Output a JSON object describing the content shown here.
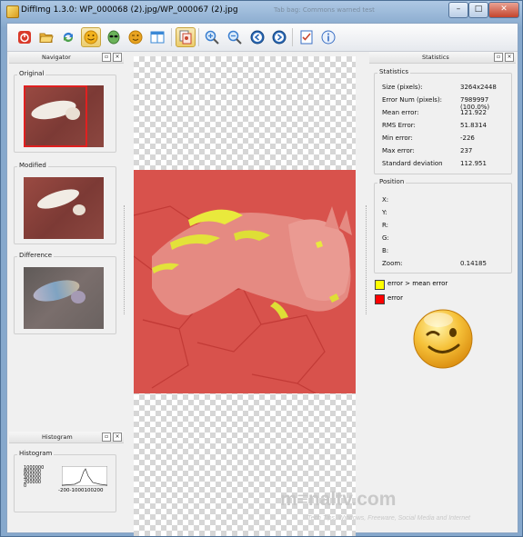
{
  "window": {
    "title": "DiffImg 1.3.0: WP_000068 (2).jpg/WP_000067 (2).jpg",
    "ghost_title": "Tab bag: Commons warned test",
    "buttons": {
      "minimize": "–",
      "maximize": "□",
      "close": "✕"
    }
  },
  "toolbar": {
    "items": [
      {
        "name": "quit-icon",
        "color": "#d93a2a"
      },
      {
        "name": "folder-open-icon",
        "color": "#f0b940"
      },
      {
        "name": "refresh-icon",
        "color": "#2f7bd1"
      },
      {
        "name": "smiley-icon",
        "color": "#f2b21c"
      },
      {
        "name": "alien-icon",
        "color": "#5aa04a"
      },
      {
        "name": "smiley-wink-icon",
        "color": "#e8a321"
      },
      {
        "name": "layout-icon",
        "color": "#3a88d6"
      },
      {
        "name": "image-compare-icon",
        "color": "#c9462e"
      },
      {
        "name": "zoom-in-icon",
        "color": "#3b7fd0"
      },
      {
        "name": "zoom-out-icon",
        "color": "#3b7fd0"
      },
      {
        "name": "previous-icon",
        "color": "#2a68b6"
      },
      {
        "name": "next-icon",
        "color": "#2a68b6"
      },
      {
        "name": "checklist-icon",
        "color": "#3a6fc4"
      },
      {
        "name": "info-icon",
        "color": "#3a6fc4"
      }
    ]
  },
  "navigator": {
    "title": "Navigator",
    "original_label": "Original",
    "modified_label": "Modified",
    "difference_label": "Difference"
  },
  "histogram": {
    "title": "Histogram",
    "group_label": "Histogram",
    "y_ticks": [
      "1000000",
      "800000",
      "600000",
      "400000",
      "200000",
      "0"
    ],
    "x_ticks": [
      "-200",
      "-100",
      "0",
      "100",
      "200"
    ]
  },
  "statistics": {
    "panel_title": "Statistics",
    "group_label": "Statistics",
    "rows": [
      {
        "label": "Size (pixels):",
        "value": "3264x2448"
      },
      {
        "label": "Error Num (pixels):",
        "value": "7989997 (100.0%)"
      },
      {
        "label": "Mean error:",
        "value": "121.922"
      },
      {
        "label": "RMS Error:",
        "value": "51.8314"
      },
      {
        "label": "Min error:",
        "value": "-226"
      },
      {
        "label": "Max error:",
        "value": "237"
      },
      {
        "label": "Standard deviation",
        "value": "112.951"
      }
    ]
  },
  "position": {
    "group_label": "Position",
    "rows": [
      {
        "label": "X:",
        "value": ""
      },
      {
        "label": "Y:",
        "value": ""
      },
      {
        "label": "R:",
        "value": ""
      },
      {
        "label": "G:",
        "value": ""
      },
      {
        "label": "B:",
        "value": ""
      },
      {
        "label": "Zoom:",
        "value": "0.14185"
      }
    ]
  },
  "legend": {
    "items": [
      {
        "label": "error > mean error",
        "color": "#ffff00"
      },
      {
        "label": "error",
        "color": "#ff0000"
      }
    ]
  },
  "watermark": {
    "logo": "m≡naltv.com",
    "tagline": "Tech Tips, Windows, Freeware, Social Media and Internet"
  }
}
